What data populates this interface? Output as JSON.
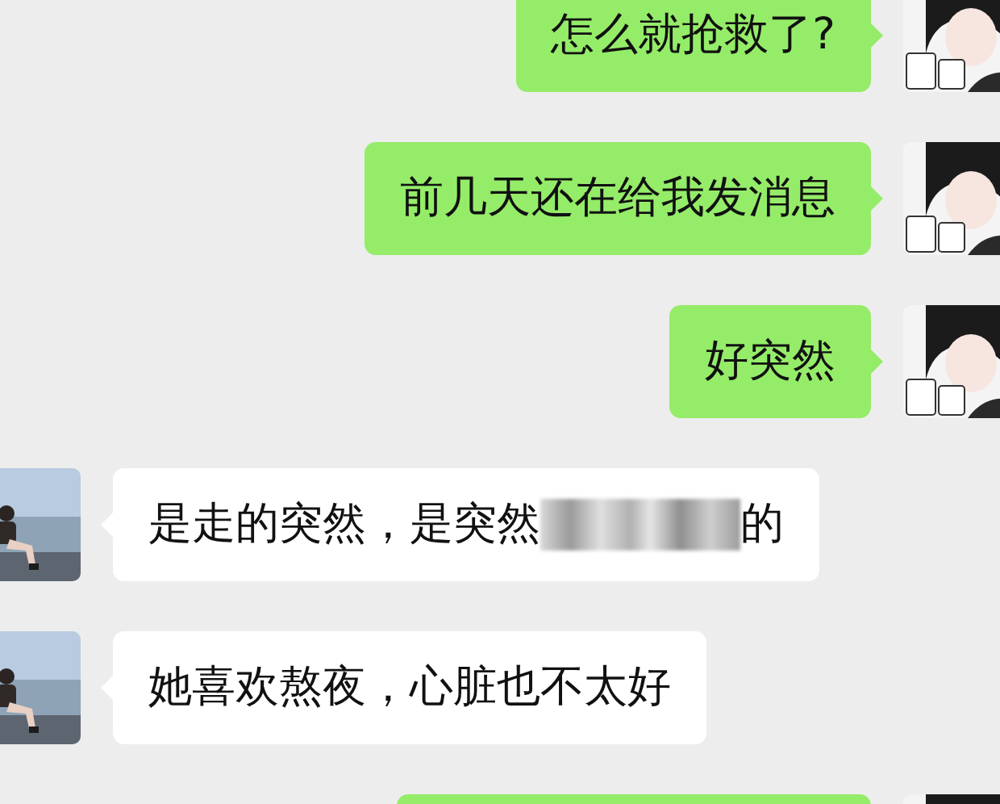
{
  "messages": [
    {
      "kind": "sent",
      "text": "怎么就抢救了?"
    },
    {
      "kind": "sent",
      "text": "前几天还在给我发消息"
    },
    {
      "kind": "sent",
      "text": "好突然"
    },
    {
      "kind": "received",
      "text": "是走的突然，是突然",
      "redacted": true,
      "text_after": "的"
    },
    {
      "kind": "received",
      "text": "她喜欢熬夜，心脏也不太好"
    },
    {
      "kind": "sent"
    }
  ]
}
